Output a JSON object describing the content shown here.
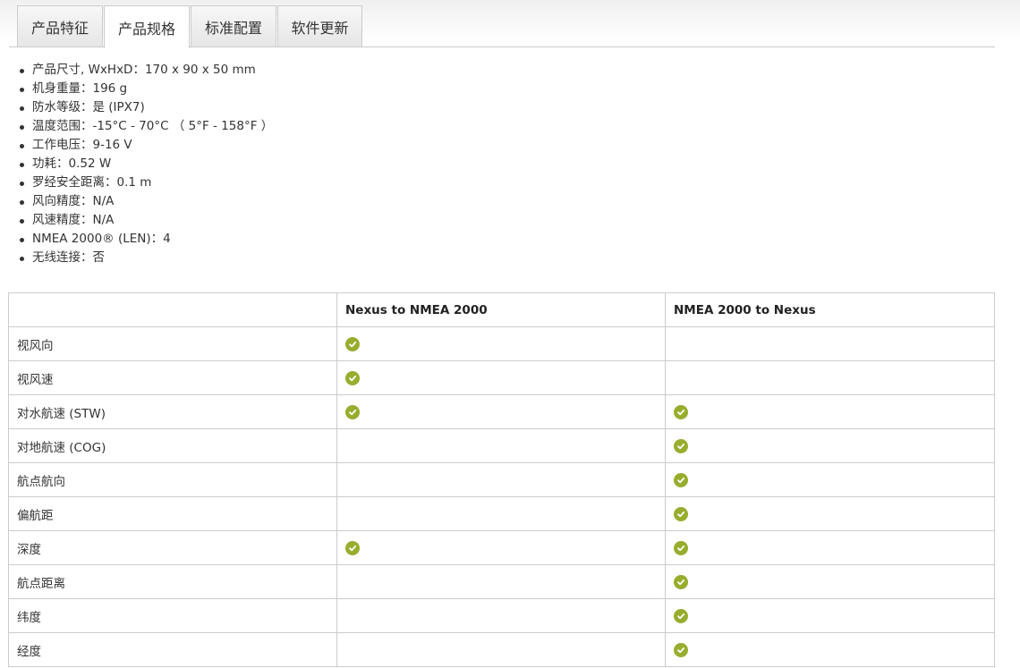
{
  "tabs": [
    {
      "label": "产品特征"
    },
    {
      "label": "产品规格"
    },
    {
      "label": "标准配置"
    },
    {
      "label": "软件更新"
    }
  ],
  "active_tab": "产品规格",
  "specs": [
    "产品尺寸, WxHxD：170 x 90 x 50 mm",
    "机身重量：196 g",
    "防水等级：是 (IPX7)",
    "温度范围：-15°C - 70°C （ 5°F - 158°F ）",
    "工作电压：9-16 V",
    "功耗：0.52 W",
    "罗经安全距离：0.1 m",
    "风向精度：N/A",
    "风速精度：N/A",
    "NMEA 2000® (LEN)：4",
    "无线连接：否"
  ],
  "table": {
    "headers": [
      "",
      "Nexus to NMEA 2000",
      "NMEA 2000 to Nexus"
    ],
    "rows": [
      {
        "label": "视风向",
        "nexus_to_nmea": true,
        "nmea_to_nexus": false
      },
      {
        "label": "视风速",
        "nexus_to_nmea": true,
        "nmea_to_nexus": false
      },
      {
        "label": "对水航速 (STW)",
        "nexus_to_nmea": true,
        "nmea_to_nexus": true
      },
      {
        "label": "对地航速 (COG)",
        "nexus_to_nmea": false,
        "nmea_to_nexus": true
      },
      {
        "label": "航点航向",
        "nexus_to_nmea": false,
        "nmea_to_nexus": true
      },
      {
        "label": "偏航距",
        "nexus_to_nmea": false,
        "nmea_to_nexus": true
      },
      {
        "label": "深度",
        "nexus_to_nmea": true,
        "nmea_to_nexus": true
      },
      {
        "label": "航点距离",
        "nexus_to_nmea": false,
        "nmea_to_nexus": true
      },
      {
        "label": "纬度",
        "nexus_to_nmea": false,
        "nmea_to_nexus": true
      },
      {
        "label": "经度",
        "nexus_to_nmea": false,
        "nmea_to_nexus": true
      }
    ]
  },
  "icons": {
    "check": "check-circle-icon"
  },
  "colors": {
    "check": "#97ad2e",
    "border": "#cccccc",
    "text": "#333333"
  }
}
